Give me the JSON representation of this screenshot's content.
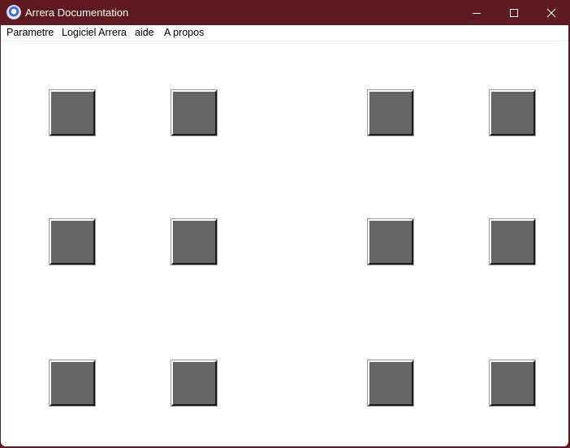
{
  "window": {
    "title": "Arrera Documentation",
    "icon": "arrera-app-icon",
    "controls": [
      "minimize-icon",
      "maximize-icon",
      "close-icon"
    ],
    "colors": {
      "titlebar": "#5e1a20",
      "client_background": "#ffffff",
      "tile": "#656565"
    }
  },
  "menubar": {
    "items": [
      {
        "label": "Parametre"
      },
      {
        "label": "Logiciel Arrera"
      },
      {
        "label": "aide"
      },
      {
        "label": "A propos"
      }
    ]
  },
  "grid": {
    "rows": 3,
    "columns": 4,
    "tiles": 12
  }
}
